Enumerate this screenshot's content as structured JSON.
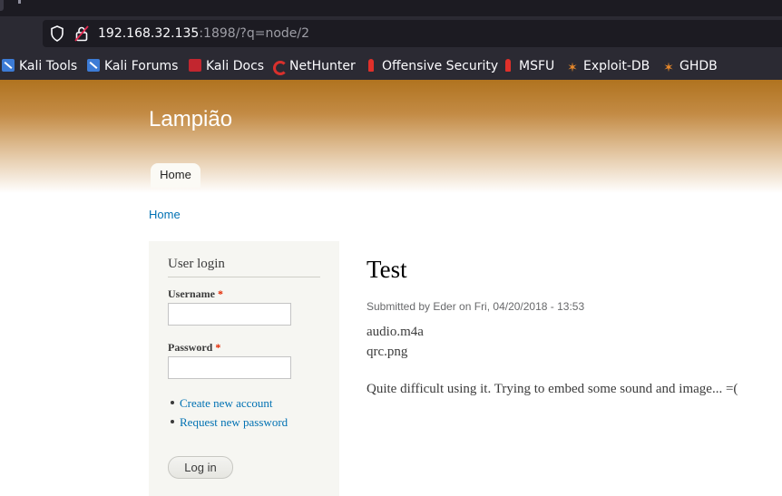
{
  "browser": {
    "url_host": "192.168.32.135",
    "url_rest": ":1898/?q=node/2",
    "bookmarks": [
      {
        "label": "Kali Tools",
        "icon": "kali-dragon-icon"
      },
      {
        "label": "Kali Forums",
        "icon": "kali-dragon-icon"
      },
      {
        "label": "Kali Docs",
        "icon": "kali-docs-icon"
      },
      {
        "label": "NetHunter",
        "icon": "nethunter-icon"
      },
      {
        "label": "Offensive Security",
        "icon": "offsec-icon"
      },
      {
        "label": "MSFU",
        "icon": "offsec-icon"
      },
      {
        "label": "Exploit-DB",
        "icon": "exploitdb-icon"
      },
      {
        "label": "GHDB",
        "icon": "exploitdb-icon"
      }
    ]
  },
  "site": {
    "name": "Lampião",
    "tabs": [
      {
        "label": "Home"
      }
    ],
    "breadcrumb": "Home"
  },
  "login_block": {
    "title": "User login",
    "username_label": "Username",
    "password_label": "Password",
    "required_mark": "*",
    "username_value": "",
    "password_value": "",
    "links": [
      "Create new account",
      "Request new password"
    ],
    "submit_label": "Log in"
  },
  "node": {
    "title": "Test",
    "submitted": "Submitted by Eder on Fri, 04/20/2018 - 13:53",
    "attachments": [
      "audio.m4a",
      "qrc.png"
    ],
    "body": "Quite difficult using it. Trying to embed some sound and image... =("
  },
  "colors": {
    "header_gradient_top": "#b0731f",
    "link": "#0071b3",
    "required": "#e32700",
    "sidebar_bg": "#f6f6f2"
  }
}
